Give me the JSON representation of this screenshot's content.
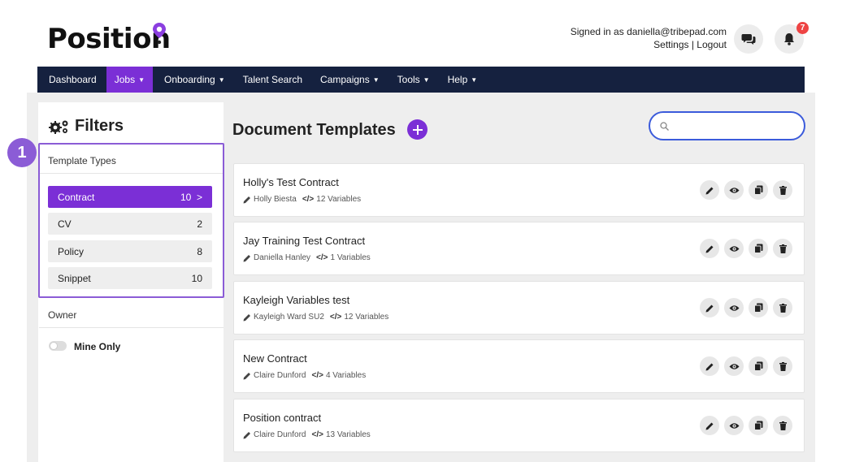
{
  "header": {
    "logo_text": "Position",
    "signed_in_text": "Signed in as daniella@tribepad.com",
    "settings_link": "Settings",
    "separator": " | ",
    "logout_link": "Logout",
    "notification_count": "7"
  },
  "nav": {
    "items": [
      {
        "label": "Dashboard",
        "has_caret": false
      },
      {
        "label": "Jobs",
        "has_caret": true,
        "active": true
      },
      {
        "label": "Onboarding",
        "has_caret": true
      },
      {
        "label": "Talent Search",
        "has_caret": false
      },
      {
        "label": "Campaigns",
        "has_caret": true
      },
      {
        "label": "Tools",
        "has_caret": true
      },
      {
        "label": "Help",
        "has_caret": true
      }
    ]
  },
  "sidebar": {
    "title": "Filters",
    "step_number": "1",
    "template_types_label": "Template Types",
    "types": [
      {
        "label": "Contract",
        "count": "10",
        "suffix": ">",
        "selected": true
      },
      {
        "label": "CV",
        "count": "2"
      },
      {
        "label": "Policy",
        "count": "8"
      },
      {
        "label": "Snippet",
        "count": "10"
      }
    ],
    "owner_label": "Owner",
    "mine_only_label": "Mine Only"
  },
  "content": {
    "title": "Document Templates",
    "search_value": "",
    "templates": [
      {
        "title": "Holly's Test Contract",
        "author": "Holly Biesta",
        "variables": "12 Variables"
      },
      {
        "title": "Jay Training Test Contract",
        "author": "Daniella Hanley",
        "variables": "1 Variables"
      },
      {
        "title": "Kayleigh Variables test",
        "author": "Kayleigh Ward SU2",
        "variables": "12 Variables"
      },
      {
        "title": "New Contract",
        "author": "Claire Dunford",
        "variables": "4 Variables"
      },
      {
        "title": "Position contract",
        "author": "Claire Dunford",
        "variables": "13 Variables"
      }
    ]
  },
  "colors": {
    "brand_purple": "#7b2fd6",
    "nav_bg": "#15213f",
    "highlight_border": "#8b5cd6",
    "search_border": "#3b5bdb",
    "badge_red": "#e44444"
  },
  "icons": {
    "logo_pin": "location-pin-icon",
    "chat": "chat-icon",
    "bell": "bell-icon",
    "filters": "gears-icon",
    "search": "search-icon",
    "edit": "pencil-icon",
    "view": "eye-icon",
    "copy": "copy-icon",
    "delete": "trash-icon",
    "author": "pencil-icon",
    "variables": "code-icon",
    "add": "plus-icon"
  }
}
